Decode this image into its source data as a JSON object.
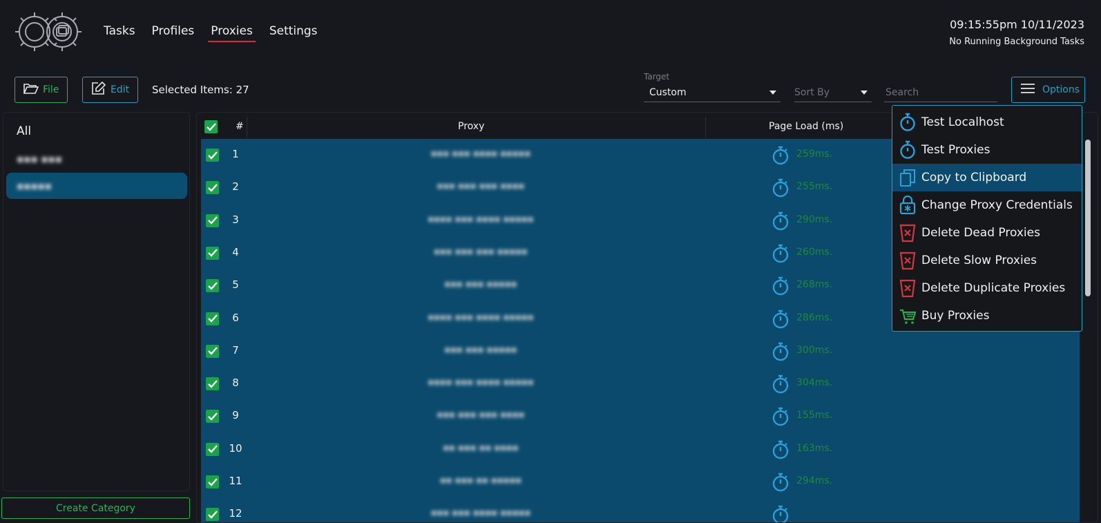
{
  "header": {
    "nav": [
      "Tasks",
      "Profiles",
      "Proxies",
      "Settings"
    ],
    "active_nav": "Proxies",
    "clock": "09:15:55pm 10/11/2023",
    "status": "No Running Background Tasks"
  },
  "toolbar": {
    "file_label": "File",
    "edit_label": "Edit",
    "selected_items": "Selected Items: 27",
    "target_label": "Target",
    "target_value": "Custom",
    "sort_placeholder": "Sort By",
    "search_placeholder": "Search",
    "options_label": "Options"
  },
  "sidebar": {
    "categories": [
      "All",
      "▪▪▪ ▪▪▪",
      "▪▪▪▪▪"
    ],
    "create_label": "Create Category"
  },
  "table": {
    "headers": {
      "num": "#",
      "proxy": "Proxy",
      "page_load": "Page Load (ms)"
    },
    "rows": [
      {
        "num": "1",
        "proxy": "▪▪▪ ▪▪▪ ▪▪▪▪ ▪▪▪▪▪",
        "load": "259ms."
      },
      {
        "num": "2",
        "proxy": "▪▪▪ ▪▪▪ ▪▪▪ ▪▪▪▪",
        "load": "255ms."
      },
      {
        "num": "3",
        "proxy": "▪▪▪▪ ▪▪▪ ▪▪▪▪ ▪▪▪▪▪",
        "load": "290ms."
      },
      {
        "num": "4",
        "proxy": "▪▪▪ ▪▪▪ ▪▪▪ ▪▪▪▪▪",
        "load": "260ms."
      },
      {
        "num": "5",
        "proxy": "▪▪▪ ▪▪▪ ▪▪▪▪▪",
        "load": "268ms."
      },
      {
        "num": "6",
        "proxy": "▪▪▪▪ ▪▪▪ ▪▪▪▪ ▪▪▪▪▪",
        "load": "286ms."
      },
      {
        "num": "7",
        "proxy": "▪▪▪ ▪▪▪ ▪▪▪▪▪",
        "load": "300ms."
      },
      {
        "num": "8",
        "proxy": "▪▪▪▪ ▪▪▪ ▪▪▪▪ ▪▪▪▪▪",
        "load": "304ms."
      },
      {
        "num": "9",
        "proxy": "▪▪▪ ▪▪▪ ▪▪▪ ▪▪▪▪",
        "load": "155ms."
      },
      {
        "num": "10",
        "proxy": "▪▪ ▪▪▪ ▪▪ ▪▪▪▪",
        "load": "163ms."
      },
      {
        "num": "11",
        "proxy": "▪▪ ▪▪▪ ▪▪ ▪▪▪▪▪",
        "load": "294ms."
      },
      {
        "num": "12",
        "proxy": "▪▪▪ ▪▪▪ ▪▪▪▪ ▪▪▪▪▪",
        "load": ""
      }
    ]
  },
  "options_menu": [
    {
      "label": "Test Localhost",
      "icon": "stopwatch-icon"
    },
    {
      "label": "Test Proxies",
      "icon": "stopwatch-icon"
    },
    {
      "label": "Copy to Clipboard",
      "icon": "copy-icon"
    },
    {
      "label": "Change Proxy Credentials",
      "icon": "lock-icon"
    },
    {
      "label": "Delete Dead Proxies",
      "icon": "delete-bucket-icon"
    },
    {
      "label": "Delete Slow Proxies",
      "icon": "delete-bucket-icon"
    },
    {
      "label": "Delete Duplicate Proxies",
      "icon": "delete-bucket-icon"
    },
    {
      "label": "Buy Proxies",
      "icon": "cart-icon"
    }
  ],
  "colors": {
    "accent_blue": "#2a9fc4",
    "accent_green": "#2bb35a",
    "nav_underline": "#e0272f",
    "selected_row": "#0b4a6c",
    "load_text": "#1f8a35"
  }
}
